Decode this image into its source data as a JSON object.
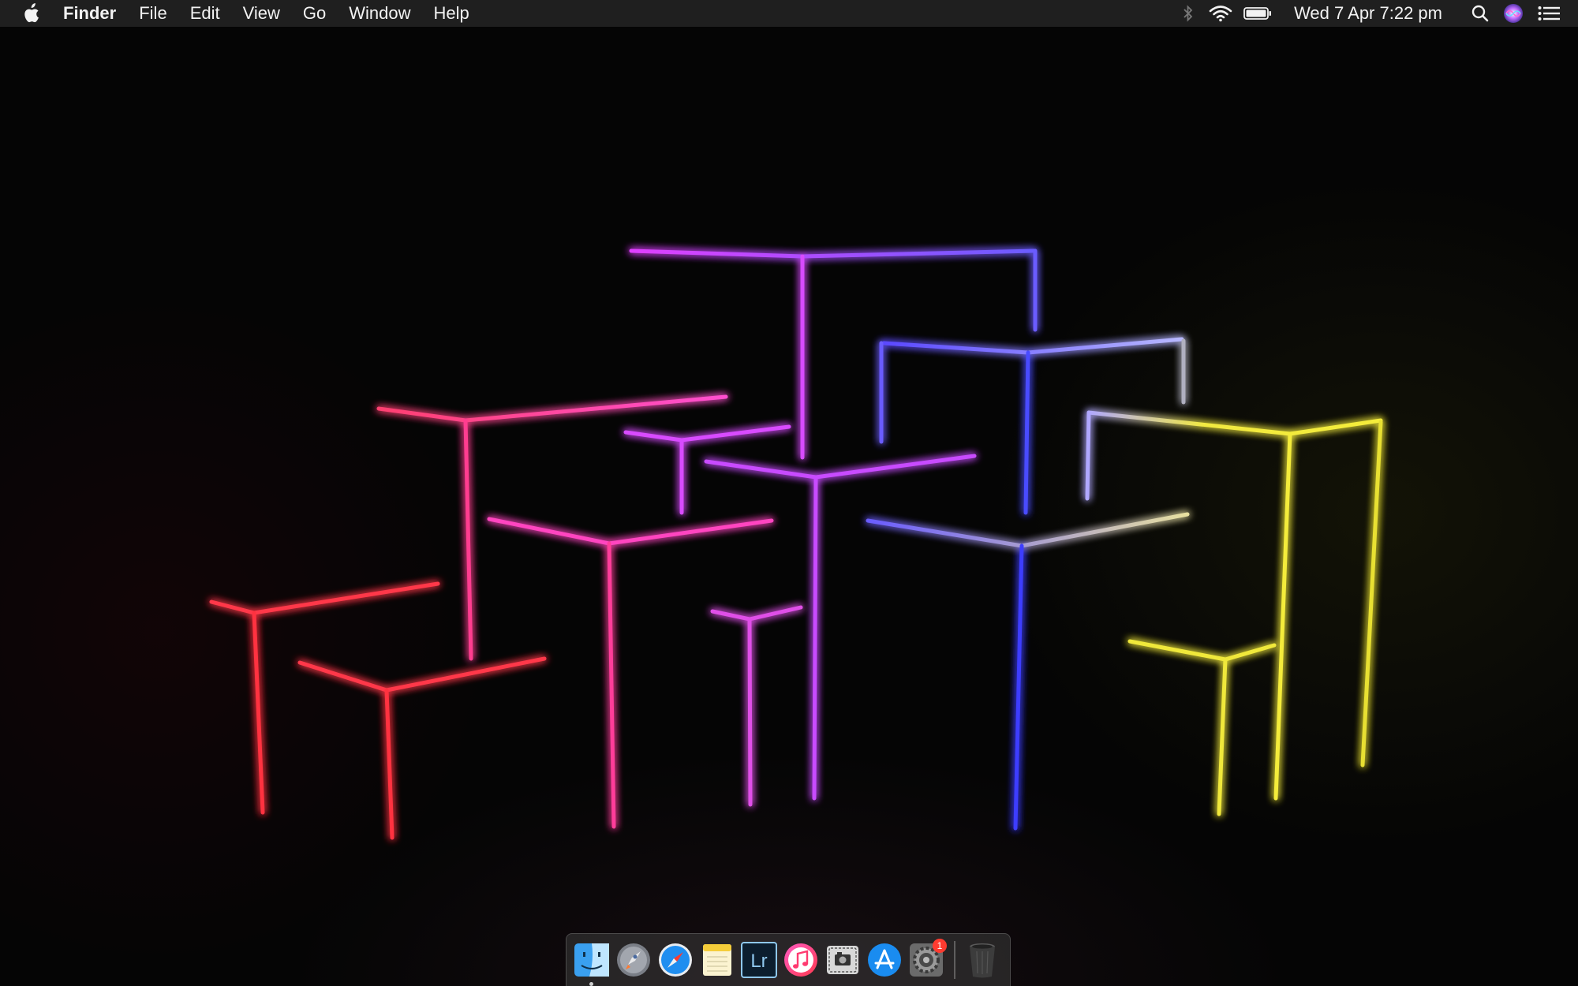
{
  "menubar": {
    "app_name": "Finder",
    "menus": [
      "File",
      "Edit",
      "View",
      "Go",
      "Window",
      "Help"
    ],
    "clock": "Wed 7 Apr  7:22 pm",
    "status_icons": [
      "bluetooth-icon",
      "wifi-icon",
      "battery-icon",
      "spotlight-search-icon",
      "siri-icon",
      "notification-center-icon"
    ]
  },
  "dock": {
    "apps": [
      {
        "name": "Finder",
        "icon": "finder-icon",
        "running": true
      },
      {
        "name": "Launchpad",
        "icon": "launchpad-icon"
      },
      {
        "name": "Safari",
        "icon": "safari-icon"
      },
      {
        "name": "Notes",
        "icon": "notes-icon"
      },
      {
        "name": "Lightroom",
        "icon": "lightroom-icon",
        "label": "Lr"
      },
      {
        "name": "iTunes",
        "icon": "itunes-icon"
      },
      {
        "name": "Screenshot",
        "icon": "screenshot-icon"
      },
      {
        "name": "App Store",
        "icon": "app-store-icon"
      },
      {
        "name": "System Preferences",
        "icon": "system-preferences-icon",
        "badge": "1"
      },
      {
        "name": "Trash",
        "icon": "trash-icon"
      }
    ]
  },
  "colors": {
    "menubar_bg": "#1f1f1f",
    "neon_red": "#ff3848",
    "neon_pink": "#ff3cc8",
    "neon_magenta": "#d84cff",
    "neon_blue": "#4a4cff",
    "neon_yellow": "#f4ec3a"
  }
}
